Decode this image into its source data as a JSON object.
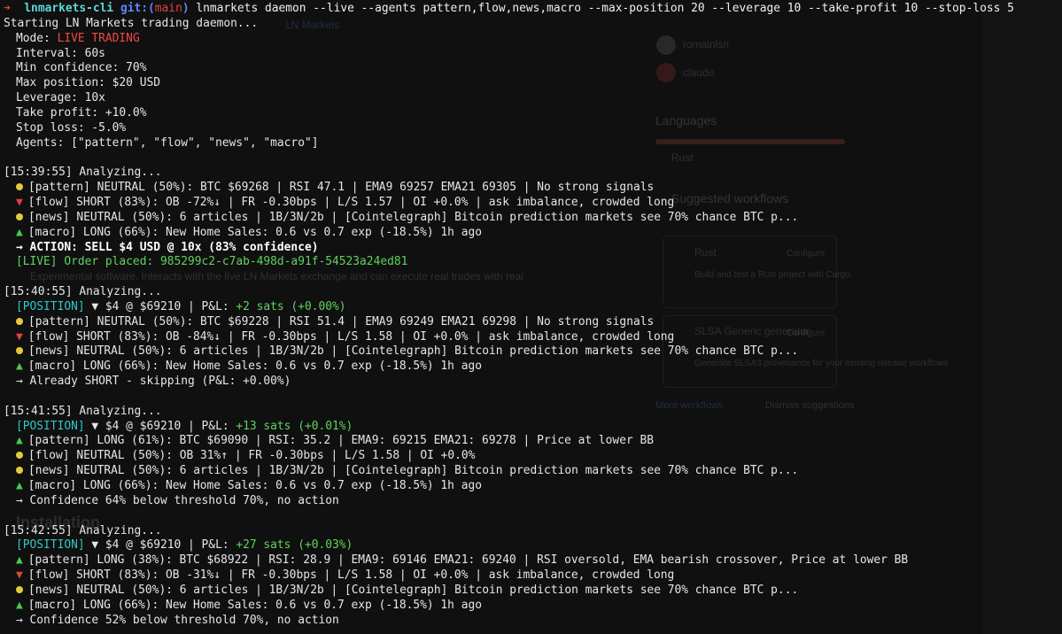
{
  "prompt": {
    "arrow": "➜",
    "dir": "lnmarkets-cli",
    "git_label": "git:(",
    "branch": "main",
    "git_close": ")",
    "command": "lnmarkets daemon --live --agents pattern,flow,news,macro --max-position 20 --leverage 10 --take-profit 10 --stop-loss 5"
  },
  "config": {
    "starting": "Starting LN Markets trading daemon...",
    "mode_label": "Mode: ",
    "mode_value": "LIVE TRADING",
    "interval": "Interval: 60s",
    "min_confidence": "Min confidence: 70%",
    "max_position": "Max position: $20 USD",
    "leverage": "Leverage: 10x",
    "take_profit": "Take profit: +10.0%",
    "stop_loss": "Stop loss: -5.0%",
    "agents": "Agents: [\"pattern\", \"flow\", \"news\", \"macro\"]"
  },
  "cycles": [
    {
      "header": "[15:39:55] Analyzing...",
      "signals": [
        {
          "icon": "dot",
          "text": "[pattern] NEUTRAL (50%): BTC $69268 | RSI 47.1 | EMA9 69257 EMA21 69305 | No strong signals"
        },
        {
          "icon": "down",
          "text": "[flow] SHORT (83%): OB -72%↓ | FR -0.30bps | L/S 1.57 | OI +0.0% | ask imbalance, crowded long"
        },
        {
          "icon": "dot",
          "text": "[news] NEUTRAL (50%): 6 articles | 1B/3N/2b | [Cointelegraph] Bitcoin prediction markets see 70% chance BTC p..."
        },
        {
          "icon": "up",
          "text": "[macro] LONG (66%): New Home Sales: 0.6 vs 0.7 exp (-18.5%) 1h ago"
        }
      ],
      "action": "→ ACTION: SELL $4 USD @ 10x (83% confidence)",
      "order": "[LIVE] Order placed: 985299c2-c7ab-498d-a91f-54523a24ed81"
    },
    {
      "header": "[15:40:55] Analyzing...",
      "position_label": "[POSITION]",
      "position_text": " ▼ $4 @ $69210 | P&L: ",
      "pnl": "+2 sats (+0.00%)",
      "signals": [
        {
          "icon": "dot",
          "text": "[pattern] NEUTRAL (50%): BTC $69228 | RSI 51.4 | EMA9 69249 EMA21 69298 | No strong signals"
        },
        {
          "icon": "down",
          "text": "[flow] SHORT (83%): OB -84%↓ | FR -0.30bps | L/S 1.58 | OI +0.0% | ask imbalance, crowded long"
        },
        {
          "icon": "dot",
          "text": "[news] NEUTRAL (50%): 6 articles | 1B/3N/2b | [Cointelegraph] Bitcoin prediction markets see 70% chance BTC p..."
        },
        {
          "icon": "up",
          "text": "[macro] LONG (66%): New Home Sales: 0.6 vs 0.7 exp (-18.5%) 1h ago"
        }
      ],
      "result": "→ Already SHORT - skipping (P&L: +0.00%)"
    },
    {
      "header": "[15:41:55] Analyzing...",
      "position_label": "[POSITION]",
      "position_text": " ▼ $4 @ $69210 | P&L: ",
      "pnl": "+13 sats (+0.01%)",
      "signals": [
        {
          "icon": "up",
          "text": "[pattern] LONG (61%): BTC $69090 | RSI: 35.2 | EMA9: 69215 EMA21: 69278 | Price at lower BB"
        },
        {
          "icon": "dot",
          "text": "[flow] NEUTRAL (50%): OB 31%↑ | FR -0.30bps | L/S 1.58 | OI +0.0%"
        },
        {
          "icon": "dot",
          "text": "[news] NEUTRAL (50%): 6 articles | 1B/3N/2b | [Cointelegraph] Bitcoin prediction markets see 70% chance BTC p..."
        },
        {
          "icon": "up",
          "text": "[macro] LONG (66%): New Home Sales: 0.6 vs 0.7 exp (-18.5%) 1h ago"
        }
      ],
      "result": "→ Confidence 64% below threshold 70%, no action"
    },
    {
      "header": "[15:42:55] Analyzing...",
      "position_label": "[POSITION]",
      "position_text": " ▼ $4 @ $69210 | P&L: ",
      "pnl": "+27 sats (+0.03%)",
      "signals": [
        {
          "icon": "up",
          "text": "[pattern] LONG (38%): BTC $68922 | RSI: 28.9 | EMA9: 69146 EMA21: 69240 | RSI oversold, EMA bearish crossover, Price at lower BB"
        },
        {
          "icon": "down",
          "text": "[flow] SHORT (83%): OB -31%↓ | FR -0.30bps | L/S 1.58 | OI +0.0% | ask imbalance, crowded long"
        },
        {
          "icon": "dot",
          "text": "[news] NEUTRAL (50%): 6 articles | 1B/3N/2b | [Cointelegraph] Bitcoin prediction markets see 70% chance BTC p..."
        },
        {
          "icon": "up",
          "text": "[macro] LONG (66%): New Home Sales: 0.6 vs 0.7 exp (-18.5%) 1h ago"
        }
      ],
      "result": "→ Confidence 52% below threshold 70%, no action"
    }
  ],
  "background": {
    "link1": "LN Markets",
    "contrib1": "romainlsn",
    "contrib2": "claude",
    "languages_title": "Languages",
    "language": "Rust",
    "workflows_title": "Suggested workflows",
    "workflow1": "Rust",
    "configure": "Configure",
    "workflow1_desc": "Build and test a Rust project with Cargo.",
    "workflow2": "SLSA Generic generator",
    "workflow2_desc": "Generate SLSA3 provenance for your existing release workflows",
    "more_workflows": "More workflows",
    "dismiss": "Dismiss suggestions",
    "installation": "Installation",
    "desc": "Experimental software. Interacts with the live LN Markets exchange and can execute real trades with real"
  }
}
